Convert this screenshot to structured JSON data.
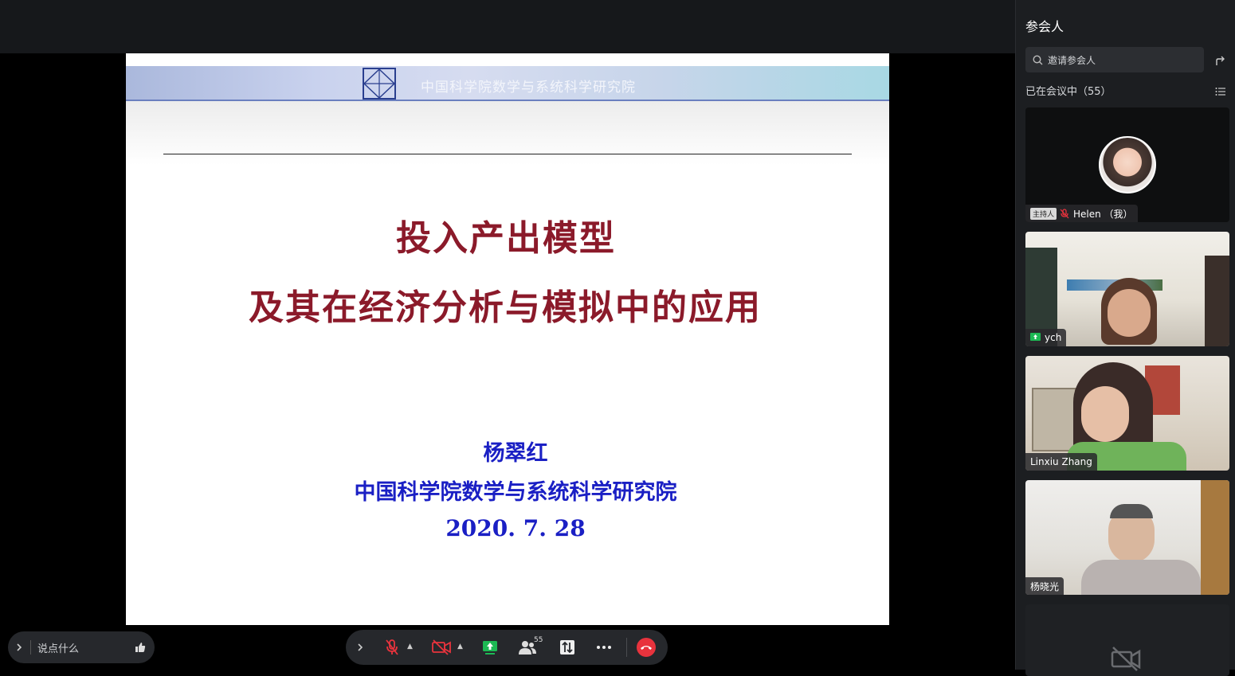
{
  "slide": {
    "banner_text": "中国科学院数学与系统科学研究院",
    "title_line1": "投入产出模型",
    "title_line2": "及其在经济分析与模拟中的应用",
    "author": "杨翠红",
    "institute": "中国科学院数学与系统科学研究院",
    "date": "2020. 7. 28"
  },
  "chat": {
    "placeholder": "说点什么"
  },
  "toolbar": {
    "participant_count": "55"
  },
  "panel": {
    "title": "参会人",
    "invite_placeholder": "邀请参会人",
    "in_meeting_label": "已在会议中（55）",
    "participants": [
      {
        "name": "Helen （我）",
        "badge": "主持人"
      },
      {
        "name": "ych"
      },
      {
        "name": "Linxiu Zhang"
      },
      {
        "name": "杨晓光"
      }
    ]
  },
  "colors": {
    "slide_title": "#8b1a2a",
    "slide_info": "#1a1fc4",
    "end_call": "#e8333d",
    "share_green": "#1db954",
    "muted_red": "#e8333d"
  },
  "icons": [
    "chevron-right-icon",
    "thumbs-up-icon",
    "mic-muted-icon",
    "camera-off-icon",
    "share-screen-icon",
    "participants-icon",
    "layout-icon",
    "more-icon",
    "end-call-icon",
    "search-icon",
    "share-icon",
    "list-icon"
  ]
}
